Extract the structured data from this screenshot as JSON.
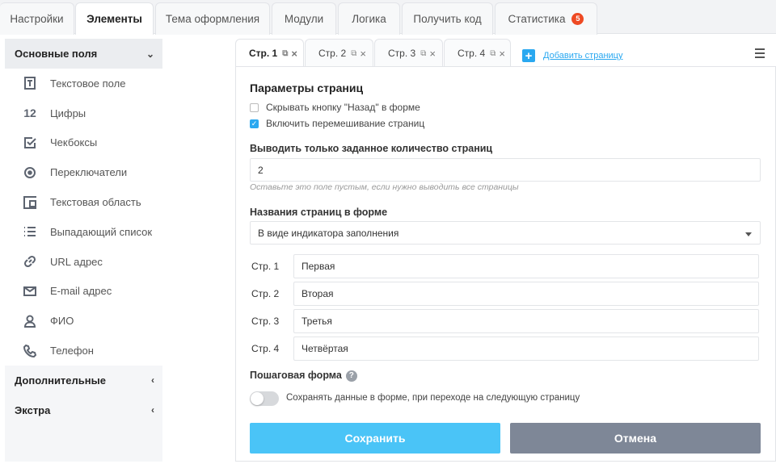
{
  "top_tabs": [
    {
      "label": "Настройки"
    },
    {
      "label": "Элементы"
    },
    {
      "label": "Тема оформления"
    },
    {
      "label": "Модули"
    },
    {
      "label": "Логика"
    },
    {
      "label": "Получить код"
    },
    {
      "label": "Статистика",
      "badge": "5"
    }
  ],
  "sidebar": {
    "groups": [
      {
        "label": "Основные поля",
        "chevron": "⌄"
      },
      {
        "label": "Дополнительные",
        "chevron": "‹"
      },
      {
        "label": "Экстра",
        "chevron": "‹"
      }
    ],
    "items": [
      {
        "label": "Текстовое поле",
        "icon": "text-field-icon"
      },
      {
        "label": "Цифры",
        "icon": "numbers-icon",
        "icon_text": "12"
      },
      {
        "label": "Чекбоксы",
        "icon": "checkbox-icon"
      },
      {
        "label": "Переключатели",
        "icon": "radio-icon"
      },
      {
        "label": "Текстовая область",
        "icon": "textarea-icon"
      },
      {
        "label": "Выпадающий список",
        "icon": "list-icon"
      },
      {
        "label": "URL адрес",
        "icon": "link-icon"
      },
      {
        "label": "E-mail адрес",
        "icon": "mail-icon"
      },
      {
        "label": "ФИО",
        "icon": "user-icon"
      },
      {
        "label": "Телефон",
        "icon": "phone-icon"
      }
    ]
  },
  "page_tabs": [
    {
      "label": "Стр. 1"
    },
    {
      "label": "Стр. 2"
    },
    {
      "label": "Стр. 3"
    },
    {
      "label": "Стр. 4"
    }
  ],
  "add_page_label": "Добавить страницу",
  "panel": {
    "title": "Параметры страниц",
    "hide_back_label": "Скрывать кнопку \"Назад\" в форме",
    "shuffle_label": "Включить перемешивание страниц",
    "limit_label": "Выводить только заданное количество страниц",
    "limit_value": "2",
    "limit_hint": "Оставьте это поле пустым, если нужно выводить все страницы",
    "names_label": "Названия страниц в форме",
    "names_select": "В виде индикатора заполнения",
    "pages": [
      {
        "label": "Стр. 1",
        "value": "Первая"
      },
      {
        "label": "Стр. 2",
        "value": "Вторая"
      },
      {
        "label": "Стр. 3",
        "value": "Третья"
      },
      {
        "label": "Стр. 4",
        "value": "Четвёртая"
      }
    ],
    "stepwise_label": "Пошаговая форма",
    "help_glyph": "?",
    "save_data_label": "Сохранять данные в форме, при переходе на следующую страницу",
    "save_button": "Сохранить",
    "cancel_button": "Отмена"
  },
  "colors": {
    "accent": "#2aa8f0",
    "save": "#4ac4f7",
    "cancel": "#7e8797",
    "badge": "#ee4a23"
  }
}
